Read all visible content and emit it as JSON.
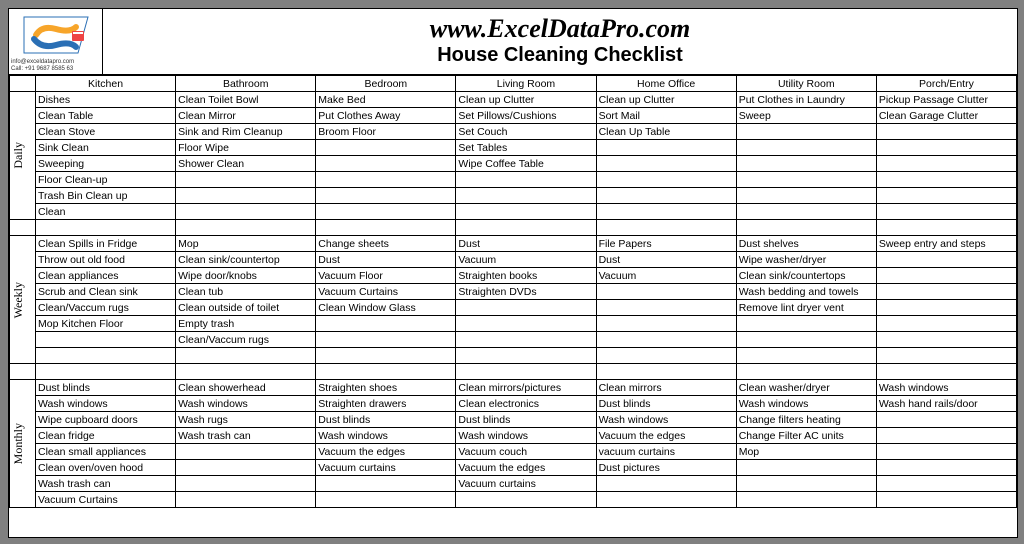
{
  "site_url": "www.ExcelDataPro.com",
  "title": "House Cleaning Checklist",
  "contact_email": "info@exceldatapro.com",
  "contact_phone": "Call: +91 9687 8585 63",
  "columns": [
    "Kitchen",
    "Bathroom",
    "Bedroom",
    "Living Room",
    "Home Office",
    "Utility Room",
    "Porch/Entry"
  ],
  "sections": [
    {
      "label": "Daily",
      "rows": [
        [
          "Dishes",
          "Clean Toilet Bowl",
          "Make Bed",
          "Clean up Clutter",
          "Clean up Clutter",
          "Put Clothes in Laundry",
          "Pickup Passage Clutter"
        ],
        [
          "Clean Table",
          "Clean Mirror",
          "Put Clothes Away",
          "Set Pillows/Cushions",
          "Sort Mail",
          "Sweep",
          "Clean Garage Clutter"
        ],
        [
          "Clean Stove",
          "Sink and Rim Cleanup",
          "Broom Floor",
          "Set Couch",
          "Clean Up Table",
          "",
          ""
        ],
        [
          "Sink Clean",
          "Floor Wipe",
          "",
          "Set Tables",
          "",
          "",
          ""
        ],
        [
          "Sweeping",
          "Shower Clean",
          "",
          "Wipe Coffee Table",
          "",
          "",
          ""
        ],
        [
          "Floor Clean-up",
          "",
          "",
          "",
          "",
          "",
          ""
        ],
        [
          "Trash Bin Clean up",
          "",
          "",
          "",
          "",
          "",
          ""
        ],
        [
          "Clean",
          "",
          "",
          "",
          "",
          "",
          ""
        ]
      ]
    },
    {
      "label": "Weekly",
      "rows": [
        [
          "Clean Spills in Fridge",
          "Mop",
          "Change sheets",
          "Dust",
          "File Papers",
          "Dust shelves",
          "Sweep entry and steps"
        ],
        [
          "Throw out old food",
          "Clean sink/countertop",
          "Dust",
          "Vacuum",
          "Dust",
          "Wipe washer/dryer",
          ""
        ],
        [
          "Clean appliances",
          "Wipe door/knobs",
          "Vacuum Floor",
          "Straighten books",
          "Vacuum",
          "Clean sink/countertops",
          ""
        ],
        [
          "Scrub and Clean sink",
          "Clean tub",
          "Vacuum Curtains",
          "Straighten DVDs",
          "",
          "Wash bedding and towels",
          ""
        ],
        [
          "Clean/Vaccum rugs",
          "Clean outside of toilet",
          "Clean Window Glass",
          "",
          "",
          "Remove lint dryer vent",
          ""
        ],
        [
          "Mop Kitchen Floor",
          "Empty trash",
          "",
          "",
          "",
          "",
          ""
        ],
        [
          "",
          "Clean/Vaccum rugs",
          "",
          "",
          "",
          "",
          ""
        ],
        [
          "",
          "",
          "",
          "",
          "",
          "",
          ""
        ]
      ]
    },
    {
      "label": "Monthly",
      "rows": [
        [
          "Dust blinds",
          "Clean showerhead",
          "Straighten shoes",
          "Clean mirrors/pictures",
          "Clean mirrors",
          "Clean washer/dryer",
          "Wash windows"
        ],
        [
          "Wash windows",
          "Wash windows",
          "Straighten drawers",
          "Clean electronics",
          "Dust blinds",
          "Wash windows",
          "Wash hand rails/door"
        ],
        [
          "Wipe cupboard doors",
          "Wash rugs",
          "Dust blinds",
          "Dust blinds",
          "Wash windows",
          "Change filters heating",
          ""
        ],
        [
          "Clean fridge",
          "Wash trash can",
          "Wash windows",
          "Wash windows",
          "Vacuum the edges",
          "Change Filter AC units",
          ""
        ],
        [
          "Clean small appliances",
          "",
          "Vacuum the edges",
          "Vacuum couch",
          "vacuum curtains",
          "Mop",
          ""
        ],
        [
          "Clean oven/oven hood",
          "",
          "Vacuum curtains",
          "Vacuum the edges",
          "Dust pictures",
          "",
          ""
        ],
        [
          "Wash trash can",
          "",
          "",
          "Vacuum curtains",
          "",
          "",
          ""
        ],
        [
          "Vacuum Curtains",
          "",
          "",
          "",
          "",
          "",
          ""
        ]
      ]
    }
  ]
}
